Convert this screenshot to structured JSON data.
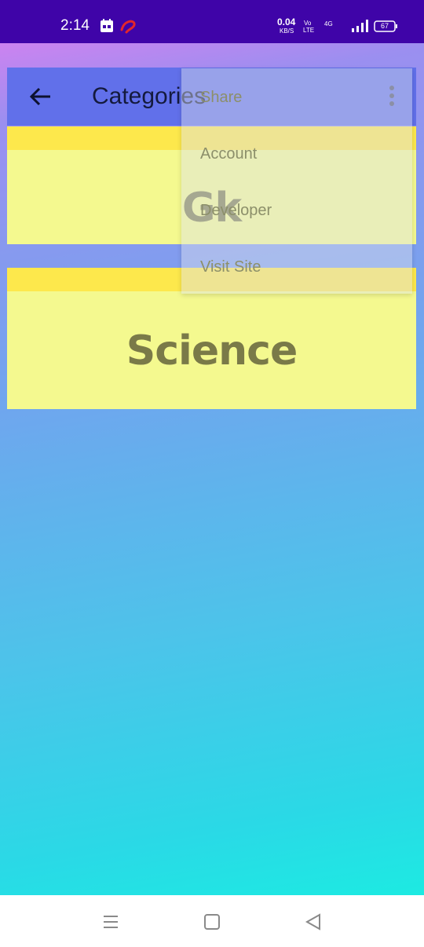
{
  "status_bar": {
    "time": "2:14",
    "speed_value": "0.04",
    "speed_unit": "KB/S",
    "volte_top": "Vo",
    "volte_bottom": "LTE",
    "network": "4G",
    "battery": "67",
    "icons": [
      "calendar-icon",
      "airtel-icon",
      "signal-icon",
      "battery-icon"
    ]
  },
  "app_bar": {
    "title": "Categories",
    "back_icon": "arrow-back-icon",
    "more_icon": "more-vert-icon",
    "color": "#6170ea"
  },
  "categories": [
    {
      "label": "Gk"
    },
    {
      "label": "Science"
    }
  ],
  "overflow_menu": {
    "items": [
      "Share",
      "Account",
      "Developer",
      "Visit Site"
    ]
  },
  "nav_bar": {
    "icons": [
      "menu-icon",
      "home-square-icon",
      "back-triangle-icon"
    ]
  },
  "colors": {
    "status_bar": "#3f04a8",
    "card_fill": "#f4f98f",
    "card_stripe": "#fde84c",
    "card_text": "#7a7a48"
  }
}
